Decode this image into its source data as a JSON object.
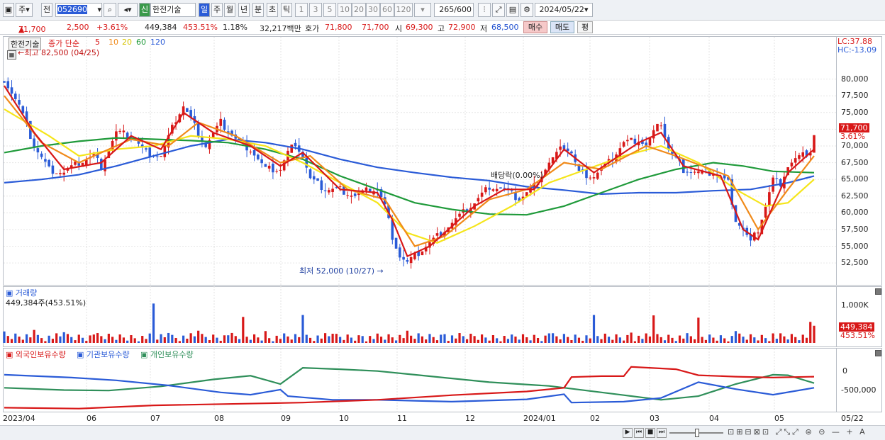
{
  "toolbar": {
    "mode1": "주",
    "mode2": "전",
    "code": "052690",
    "name_badge": "신",
    "name": "한전기술",
    "periods": [
      "일",
      "주",
      "월",
      "년",
      "분",
      "초",
      "틱"
    ],
    "minutes": [
      "1",
      "3",
      "5",
      "10",
      "20",
      "30",
      "60",
      "120"
    ],
    "count": "265",
    "count_total": "/600",
    "date": "2024/05/22"
  },
  "quote": {
    "price": "71,700",
    "arrow": "▲",
    "change": "2,500",
    "rate": "+3.61%",
    "volume": "449,384",
    "vol_rate": "453.51%",
    "turnover": "1.18%",
    "amount": "32,217백만",
    "hoga_label": "호가",
    "ask": "71,800",
    "bid": "71,700",
    "open_label": "시",
    "open": "69,300",
    "high_label": "고",
    "high": "72,900",
    "low_label": "저",
    "low": "68,500",
    "buy": "매수",
    "sell": "매도",
    "avg": "평"
  },
  "price_pane": {
    "stock": "한전기술",
    "ma_label": "종가 단순",
    "ma_periods": [
      "5",
      "10",
      "20",
      "60",
      "120"
    ],
    "ma_colors": [
      "#d81818",
      "#f08a1a",
      "#f5e51a",
      "#1f9a3a",
      "#2a5bd7"
    ],
    "max_label": "최고 82,500 (04/25)",
    "min_label": "최저 52,000 (10/27)",
    "dividend_label": "배당락(0.00%)",
    "lc": "LC:37.88",
    "hc": "HC:-13.09",
    "y_ticks": [
      "80,000",
      "77,500",
      "75,000",
      "72,500",
      "70,000",
      "67,500",
      "65,000",
      "62,500",
      "60,000",
      "57,500",
      "55,000",
      "52,500"
    ],
    "last_price_tag": "71,700",
    "last_rate_tag": "3.61%"
  },
  "volume_pane": {
    "title": "거래량",
    "value": "449,384주(453.51%)",
    "y_tick": "1,000K",
    "tag_value": "449,384",
    "tag_rate": "453.51%"
  },
  "holders_pane": {
    "legend": [
      "외국인보유수량",
      "기관보유수량",
      "개인보유수량"
    ],
    "colors": [
      "#d81818",
      "#2a5bd7",
      "#2f8f5a"
    ],
    "y_ticks": [
      "0",
      "-500,000"
    ]
  },
  "x_axis": [
    "2023/04",
    "06",
    "07",
    "08",
    "09",
    "10",
    "11",
    "12",
    "2024/01",
    "02",
    "03",
    "04",
    "05",
    "05/22"
  ],
  "chart_data": {
    "type": "candlestick",
    "title": "한전기술",
    "ylim": [
      50500,
      82500
    ],
    "price_path": [
      [
        0,
        80000
      ],
      [
        4,
        76000
      ],
      [
        8,
        70000
      ],
      [
        12,
        66500
      ],
      [
        16,
        66000
      ],
      [
        20,
        67500
      ],
      [
        24,
        68500
      ],
      [
        26,
        67000
      ],
      [
        30,
        72000
      ],
      [
        34,
        71500
      ],
      [
        38,
        69000
      ],
      [
        42,
        68500
      ],
      [
        46,
        74000
      ],
      [
        48,
        76000
      ],
      [
        50,
        74000
      ],
      [
        54,
        70000
      ],
      [
        58,
        73500
      ],
      [
        62,
        71000
      ],
      [
        66,
        69500
      ],
      [
        70,
        66500
      ],
      [
        74,
        66500
      ],
      [
        76,
        69000
      ],
      [
        78,
        70500
      ],
      [
        80,
        68500
      ],
      [
        82,
        65000
      ],
      [
        86,
        63500
      ],
      [
        90,
        63500
      ],
      [
        94,
        62500
      ],
      [
        98,
        63500
      ],
      [
        100,
        63500
      ],
      [
        102,
        61000
      ],
      [
        104,
        56500
      ],
      [
        106,
        53500
      ],
      [
        108,
        52500
      ],
      [
        110,
        53500
      ],
      [
        114,
        55500
      ],
      [
        118,
        57500
      ],
      [
        122,
        59500
      ],
      [
        126,
        61500
      ],
      [
        130,
        64000
      ],
      [
        134,
        63500
      ],
      [
        138,
        62000
      ],
      [
        142,
        64000
      ],
      [
        146,
        67500
      ],
      [
        150,
        70000
      ],
      [
        152,
        69000
      ],
      [
        154,
        66000
      ],
      [
        158,
        65500
      ],
      [
        162,
        67500
      ],
      [
        166,
        70500
      ],
      [
        170,
        71000
      ],
      [
        172,
        70000
      ],
      [
        174,
        72000
      ],
      [
        176,
        73500
      ],
      [
        178,
        69500
      ],
      [
        182,
        66500
      ],
      [
        186,
        66000
      ],
      [
        190,
        66000
      ],
      [
        194,
        64500
      ],
      [
        196,
        59000
      ],
      [
        198,
        57500
      ],
      [
        200,
        55500
      ],
      [
        202,
        57500
      ],
      [
        204,
        61000
      ],
      [
        206,
        65000
      ],
      [
        208,
        64500
      ],
      [
        210,
        67000
      ],
      [
        212,
        68000
      ],
      [
        214,
        68500
      ],
      [
        216,
        69200
      ],
      [
        217,
        71700
      ]
    ],
    "ma5": [
      [
        0,
        79000
      ],
      [
        8,
        72000
      ],
      [
        16,
        66500
      ],
      [
        26,
        67500
      ],
      [
        34,
        71500
      ],
      [
        42,
        69500
      ],
      [
        48,
        75000
      ],
      [
        56,
        72000
      ],
      [
        66,
        70000
      ],
      [
        74,
        67000
      ],
      [
        80,
        69000
      ],
      [
        90,
        63500
      ],
      [
        100,
        63000
      ],
      [
        104,
        59000
      ],
      [
        108,
        53500
      ],
      [
        114,
        55000
      ],
      [
        126,
        61000
      ],
      [
        134,
        63500
      ],
      [
        142,
        63500
      ],
      [
        150,
        69500
      ],
      [
        158,
        66000
      ],
      [
        170,
        70500
      ],
      [
        176,
        72000
      ],
      [
        182,
        67000
      ],
      [
        192,
        65500
      ],
      [
        198,
        57500
      ],
      [
        202,
        56000
      ],
      [
        210,
        66000
      ],
      [
        217,
        69500
      ]
    ],
    "ma10": [
      [
        0,
        77500
      ],
      [
        10,
        70500
      ],
      [
        20,
        67500
      ],
      [
        34,
        71000
      ],
      [
        44,
        70000
      ],
      [
        52,
        73500
      ],
      [
        62,
        71500
      ],
      [
        74,
        67500
      ],
      [
        82,
        68500
      ],
      [
        92,
        63500
      ],
      [
        102,
        62000
      ],
      [
        110,
        55000
      ],
      [
        118,
        56500
      ],
      [
        130,
        62000
      ],
      [
        140,
        63500
      ],
      [
        150,
        67500
      ],
      [
        160,
        66500
      ],
      [
        172,
        70000
      ],
      [
        180,
        68500
      ],
      [
        194,
        65500
      ],
      [
        202,
        57500
      ],
      [
        210,
        63500
      ],
      [
        217,
        68500
      ]
    ],
    "ma20": [
      [
        0,
        75500
      ],
      [
        12,
        71500
      ],
      [
        20,
        68500
      ],
      [
        30,
        69500
      ],
      [
        40,
        70000
      ],
      [
        50,
        71500
      ],
      [
        60,
        71000
      ],
      [
        70,
        70000
      ],
      [
        80,
        67500
      ],
      [
        90,
        64500
      ],
      [
        100,
        61500
      ],
      [
        108,
        57000
      ],
      [
        116,
        55500
      ],
      [
        126,
        58000
      ],
      [
        136,
        61000
      ],
      [
        146,
        64500
      ],
      [
        156,
        66500
      ],
      [
        166,
        68500
      ],
      [
        176,
        70000
      ],
      [
        186,
        67500
      ],
      [
        196,
        63500
      ],
      [
        204,
        61000
      ],
      [
        210,
        61500
      ],
      [
        217,
        65000
      ]
    ],
    "ma60": [
      [
        0,
        69000
      ],
      [
        10,
        70000
      ],
      [
        20,
        70700
      ],
      [
        30,
        71200
      ],
      [
        40,
        71000
      ],
      [
        50,
        70800
      ],
      [
        60,
        70500
      ],
      [
        70,
        69500
      ],
      [
        80,
        68000
      ],
      [
        90,
        65500
      ],
      [
        100,
        63500
      ],
      [
        110,
        61500
      ],
      [
        120,
        60500
      ],
      [
        130,
        59800
      ],
      [
        140,
        59700
      ],
      [
        150,
        61000
      ],
      [
        160,
        63000
      ],
      [
        170,
        65000
      ],
      [
        180,
        66500
      ],
      [
        190,
        67500
      ],
      [
        198,
        67000
      ],
      [
        206,
        66200
      ],
      [
        217,
        66000
      ]
    ],
    "ma120": [
      [
        0,
        64500
      ],
      [
        10,
        65000
      ],
      [
        20,
        65700
      ],
      [
        30,
        67000
      ],
      [
        40,
        68500
      ],
      [
        50,
        70000
      ],
      [
        60,
        71000
      ],
      [
        70,
        70500
      ],
      [
        80,
        69500
      ],
      [
        90,
        68000
      ],
      [
        100,
        66800
      ],
      [
        110,
        66000
      ],
      [
        120,
        65300
      ],
      [
        130,
        64800
      ],
      [
        140,
        63900
      ],
      [
        150,
        63400
      ],
      [
        160,
        62800
      ],
      [
        170,
        63000
      ],
      [
        180,
        63000
      ],
      [
        190,
        63300
      ],
      [
        200,
        63500
      ],
      [
        210,
        64500
      ],
      [
        217,
        65500
      ]
    ],
    "volume_ylim": [
      0,
      1000
    ],
    "volume": [
      [
        0,
        300,
        1
      ],
      [
        8,
        340,
        0
      ],
      [
        16,
        280,
        1
      ],
      [
        24,
        220,
        0
      ],
      [
        40,
        1030,
        1
      ],
      [
        44,
        260,
        1
      ],
      [
        52,
        320,
        0
      ],
      [
        60,
        200,
        1
      ],
      [
        64,
        680,
        0
      ],
      [
        70,
        310,
        0
      ],
      [
        80,
        730,
        1
      ],
      [
        88,
        240,
        0
      ],
      [
        96,
        180,
        1
      ],
      [
        108,
        320,
        0
      ],
      [
        118,
        230,
        1
      ],
      [
        126,
        180,
        0
      ],
      [
        136,
        220,
        1
      ],
      [
        146,
        250,
        1
      ],
      [
        158,
        730,
        1
      ],
      [
        168,
        270,
        0
      ],
      [
        174,
        720,
        0
      ],
      [
        186,
        660,
        0
      ],
      [
        196,
        310,
        1
      ],
      [
        206,
        250,
        0
      ],
      [
        216,
        550,
        0
      ],
      [
        217,
        449,
        0
      ]
    ],
    "holders_ylim": [
      -800000,
      300000
    ],
    "foreign": [
      [
        0,
        -730000
      ],
      [
        20,
        -750000
      ],
      [
        40,
        -680000
      ],
      [
        60,
        -650000
      ],
      [
        80,
        -620000
      ],
      [
        100,
        -560000
      ],
      [
        120,
        -460000
      ],
      [
        140,
        -380000
      ],
      [
        150,
        -300000
      ],
      [
        152,
        -70000
      ],
      [
        160,
        -50000
      ],
      [
        166,
        -50000
      ],
      [
        168,
        150000
      ],
      [
        180,
        100000
      ],
      [
        186,
        -30000
      ],
      [
        196,
        -60000
      ],
      [
        206,
        -80000
      ],
      [
        217,
        -60000
      ]
    ],
    "institution": [
      [
        0,
        -20000
      ],
      [
        18,
        -80000
      ],
      [
        30,
        -140000
      ],
      [
        44,
        -250000
      ],
      [
        58,
        -400000
      ],
      [
        66,
        -450000
      ],
      [
        74,
        -340000
      ],
      [
        76,
        -480000
      ],
      [
        88,
        -560000
      ],
      [
        100,
        -560000
      ],
      [
        110,
        -580000
      ],
      [
        120,
        -600000
      ],
      [
        140,
        -550000
      ],
      [
        150,
        -440000
      ],
      [
        152,
        -620000
      ],
      [
        166,
        -600000
      ],
      [
        176,
        -520000
      ],
      [
        186,
        -180000
      ],
      [
        196,
        -330000
      ],
      [
        206,
        -450000
      ],
      [
        217,
        -300000
      ]
    ],
    "individual": [
      [
        0,
        -300000
      ],
      [
        16,
        -350000
      ],
      [
        28,
        -360000
      ],
      [
        42,
        -270000
      ],
      [
        56,
        -120000
      ],
      [
        66,
        -40000
      ],
      [
        74,
        -220000
      ],
      [
        80,
        130000
      ],
      [
        90,
        100000
      ],
      [
        100,
        60000
      ],
      [
        110,
        -20000
      ],
      [
        130,
        -180000
      ],
      [
        146,
        -260000
      ],
      [
        156,
        -360000
      ],
      [
        166,
        -460000
      ],
      [
        176,
        -560000
      ],
      [
        186,
        -480000
      ],
      [
        196,
        -220000
      ],
      [
        206,
        -20000
      ],
      [
        210,
        -30000
      ],
      [
        217,
        -200000
      ]
    ]
  }
}
